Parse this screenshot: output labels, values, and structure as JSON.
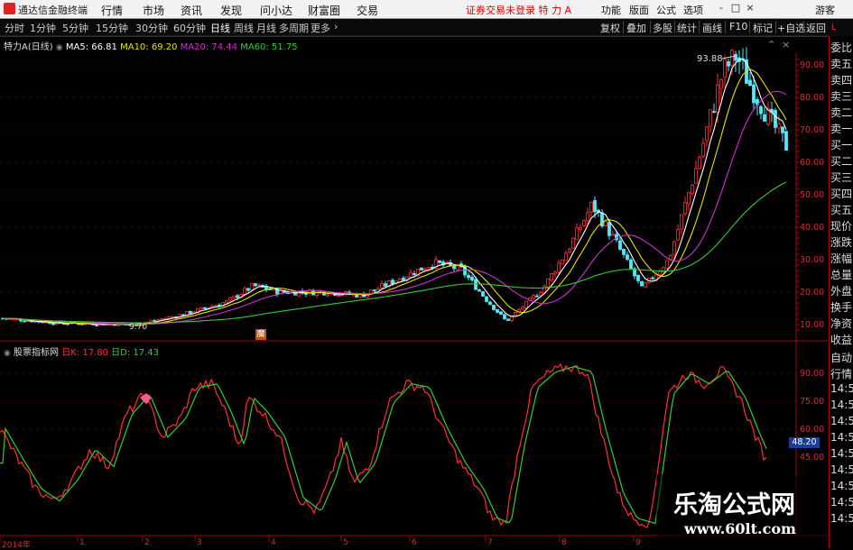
{
  "app": {
    "title": "通达信金融终端",
    "menu": [
      "行情",
      "市场",
      "资讯",
      "发现",
      "问小达",
      "财富圈",
      "交易"
    ],
    "notice": "证券交易未登录  特 力 A",
    "right_menu": [
      "功能",
      "版面",
      "公式",
      "选项"
    ],
    "user": "游客",
    "window_buttons": [
      "-",
      "□",
      "×"
    ]
  },
  "toolbar": {
    "periods": [
      "分时",
      "1分钟",
      "5分钟",
      "15分钟",
      "30分钟",
      "60分钟",
      "日线",
      "周线",
      "月线",
      "多周期",
      "更多"
    ],
    "active": "日线",
    "right_tools": [
      "复权",
      "叠加",
      "多股",
      "统计",
      "画线",
      "F10",
      "标记",
      "+自选",
      "返回"
    ]
  },
  "price_panel": {
    "legend": {
      "stock": "特力A(日线)",
      "ma5": "MA5: 66.81",
      "ma10": "MA10: 69.20",
      "ma20": "MA20: 74.44",
      "ma60": "MA60: 51.75"
    },
    "y_labels": [
      "90.00",
      "80.00",
      "70.00",
      "60.00",
      "50.00",
      "40.00",
      "30.00",
      "20.00",
      "10.00"
    ],
    "high_label": "93.88",
    "low_label": "9.70",
    "marker": "魔",
    "colors": {
      "up": "#ff3030",
      "down": "#54e8ff",
      "ma5": "#ffffff",
      "ma10": "#e8e000",
      "ma20": "#cc33cc",
      "ma60": "#33cc33"
    }
  },
  "indicator_panel": {
    "legend": {
      "name": "股票指标网",
      "k": "日K: 17.80",
      "d": "日D: 17.43"
    },
    "y_labels": [
      "90.00",
      "75.00",
      "60.00",
      "45.00"
    ],
    "current": "48.20",
    "colors": {
      "k": "#ff3030",
      "d": "#33cc33"
    }
  },
  "date_axis": [
    "2014年",
    "1",
    "2",
    "3",
    "4",
    "5",
    "6",
    "7",
    "8",
    "9"
  ],
  "side_panel": {
    "top": [
      "委比",
      "卖五",
      "卖四",
      "卖三",
      "卖二",
      "卖一",
      "买一",
      "买二",
      "买三",
      "买四",
      "买五",
      "现价",
      "涨跌",
      "涨幅",
      "总量",
      "外盘",
      "换手",
      "净资",
      "收益"
    ],
    "bottom": [
      "自动",
      "行情",
      "14:5",
      "14:5",
      "14:5",
      "14:5",
      "14:5",
      "14:5",
      "14:5",
      "14:5",
      "14:5"
    ]
  },
  "watermark": {
    "title": "乐淘公式网",
    "url": "www.60lt.com"
  }
}
